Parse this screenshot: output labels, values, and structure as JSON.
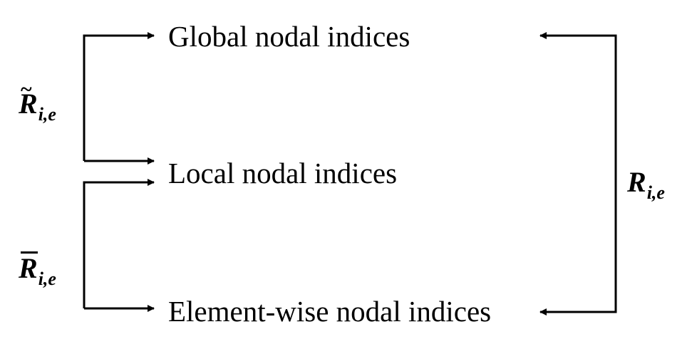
{
  "nodes": {
    "global": "Global nodal indices",
    "local": "Local nodal indices",
    "element": "Element-wise nodal indices"
  },
  "operators": {
    "tilde": {
      "symbol": "R",
      "subscript": "i,e",
      "accent": "~"
    },
    "bar": {
      "symbol": "R",
      "subscript": "i,e"
    },
    "plain": {
      "symbol": "R",
      "subscript": "i,e"
    }
  },
  "colors": {
    "stroke": "#000000",
    "background": "#ffffff"
  }
}
